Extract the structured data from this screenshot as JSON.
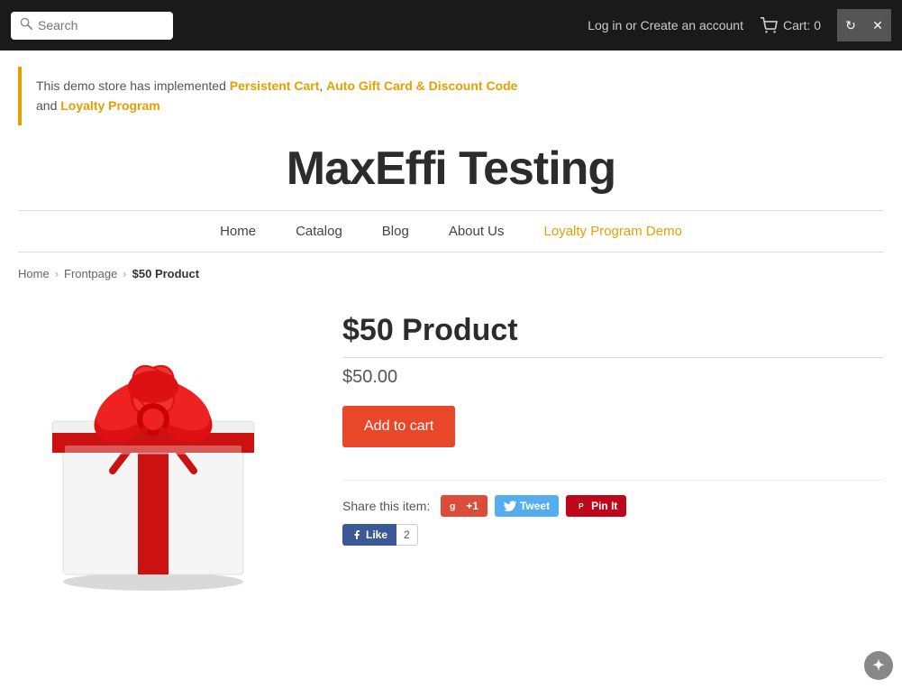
{
  "topbar": {
    "search_placeholder": "Search",
    "login_text": "Log in",
    "or_text": "or",
    "create_account_text": "Create an account",
    "cart_label": "Cart: 0",
    "win_btn_reload": "↻",
    "win_btn_close": "✕"
  },
  "notice": {
    "text_before": "This demo store has implemented ",
    "link1": "Persistent Cart",
    "separator1": ", ",
    "link2": "Auto Gift Card & Discount Code",
    "text_middle": " and ",
    "link3": "Loyalty Program"
  },
  "store": {
    "title": "MaxEffi Testing"
  },
  "nav": {
    "items": [
      {
        "label": "Home",
        "id": "home"
      },
      {
        "label": "Catalog",
        "id": "catalog"
      },
      {
        "label": "Blog",
        "id": "blog"
      },
      {
        "label": "About Us",
        "id": "about"
      },
      {
        "label": "Loyalty Program Demo",
        "id": "loyalty"
      }
    ]
  },
  "breadcrumb": {
    "home": "Home",
    "frontpage": "Frontpage",
    "current": "$50 Product"
  },
  "product": {
    "name": "$50 Product",
    "price": "$50.00",
    "add_to_cart": "Add to cart",
    "share_label": "Share this item:"
  },
  "social": {
    "gplus": "+1",
    "tweet": "Tweet",
    "pin": "Pin It",
    "like": "Like",
    "like_count": "2"
  }
}
